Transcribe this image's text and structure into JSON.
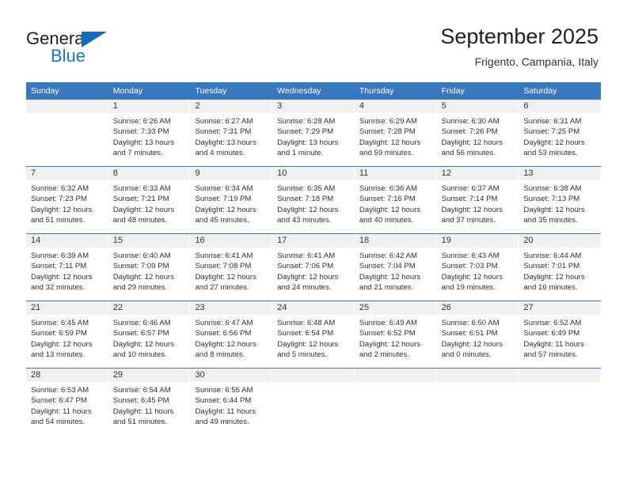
{
  "brand": {
    "name_part1": "General",
    "name_part2": "Blue",
    "accent_color": "#1b75bb",
    "triangle_color": "#156cb4"
  },
  "header": {
    "title": "September 2025",
    "subtitle": "Frigento, Campania, Italy"
  },
  "theme": {
    "header_row_bg": "#3a78bd",
    "day_band_bg": "#f0f0f0",
    "row_divider": "#3a78bd"
  },
  "weekdays": [
    "Sunday",
    "Monday",
    "Tuesday",
    "Wednesday",
    "Thursday",
    "Friday",
    "Saturday"
  ],
  "weeks": [
    [
      {
        "day": "",
        "lines": []
      },
      {
        "day": "1",
        "lines": [
          "Sunrise: 6:26 AM",
          "Sunset: 7:33 PM",
          "Daylight: 13 hours",
          "and 7 minutes."
        ]
      },
      {
        "day": "2",
        "lines": [
          "Sunrise: 6:27 AM",
          "Sunset: 7:31 PM",
          "Daylight: 13 hours",
          "and 4 minutes."
        ]
      },
      {
        "day": "3",
        "lines": [
          "Sunrise: 6:28 AM",
          "Sunset: 7:29 PM",
          "Daylight: 13 hours",
          "and 1 minute."
        ]
      },
      {
        "day": "4",
        "lines": [
          "Sunrise: 6:29 AM",
          "Sunset: 7:28 PM",
          "Daylight: 12 hours",
          "and 59 minutes."
        ]
      },
      {
        "day": "5",
        "lines": [
          "Sunrise: 6:30 AM",
          "Sunset: 7:26 PM",
          "Daylight: 12 hours",
          "and 56 minutes."
        ]
      },
      {
        "day": "6",
        "lines": [
          "Sunrise: 6:31 AM",
          "Sunset: 7:25 PM",
          "Daylight: 12 hours",
          "and 53 minutes."
        ]
      }
    ],
    [
      {
        "day": "7",
        "lines": [
          "Sunrise: 6:32 AM",
          "Sunset: 7:23 PM",
          "Daylight: 12 hours",
          "and 51 minutes."
        ]
      },
      {
        "day": "8",
        "lines": [
          "Sunrise: 6:33 AM",
          "Sunset: 7:21 PM",
          "Daylight: 12 hours",
          "and 48 minutes."
        ]
      },
      {
        "day": "9",
        "lines": [
          "Sunrise: 6:34 AM",
          "Sunset: 7:19 PM",
          "Daylight: 12 hours",
          "and 45 minutes."
        ]
      },
      {
        "day": "10",
        "lines": [
          "Sunrise: 6:35 AM",
          "Sunset: 7:18 PM",
          "Daylight: 12 hours",
          "and 43 minutes."
        ]
      },
      {
        "day": "11",
        "lines": [
          "Sunrise: 6:36 AM",
          "Sunset: 7:16 PM",
          "Daylight: 12 hours",
          "and 40 minutes."
        ]
      },
      {
        "day": "12",
        "lines": [
          "Sunrise: 6:37 AM",
          "Sunset: 7:14 PM",
          "Daylight: 12 hours",
          "and 37 minutes."
        ]
      },
      {
        "day": "13",
        "lines": [
          "Sunrise: 6:38 AM",
          "Sunset: 7:13 PM",
          "Daylight: 12 hours",
          "and 35 minutes."
        ]
      }
    ],
    [
      {
        "day": "14",
        "lines": [
          "Sunrise: 6:39 AM",
          "Sunset: 7:11 PM",
          "Daylight: 12 hours",
          "and 32 minutes."
        ]
      },
      {
        "day": "15",
        "lines": [
          "Sunrise: 6:40 AM",
          "Sunset: 7:09 PM",
          "Daylight: 12 hours",
          "and 29 minutes."
        ]
      },
      {
        "day": "16",
        "lines": [
          "Sunrise: 6:41 AM",
          "Sunset: 7:08 PM",
          "Daylight: 12 hours",
          "and 27 minutes."
        ]
      },
      {
        "day": "17",
        "lines": [
          "Sunrise: 6:41 AM",
          "Sunset: 7:06 PM",
          "Daylight: 12 hours",
          "and 24 minutes."
        ]
      },
      {
        "day": "18",
        "lines": [
          "Sunrise: 6:42 AM",
          "Sunset: 7:04 PM",
          "Daylight: 12 hours",
          "and 21 minutes."
        ]
      },
      {
        "day": "19",
        "lines": [
          "Sunrise: 6:43 AM",
          "Sunset: 7:03 PM",
          "Daylight: 12 hours",
          "and 19 minutes."
        ]
      },
      {
        "day": "20",
        "lines": [
          "Sunrise: 6:44 AM",
          "Sunset: 7:01 PM",
          "Daylight: 12 hours",
          "and 16 minutes."
        ]
      }
    ],
    [
      {
        "day": "21",
        "lines": [
          "Sunrise: 6:45 AM",
          "Sunset: 6:59 PM",
          "Daylight: 12 hours",
          "and 13 minutes."
        ]
      },
      {
        "day": "22",
        "lines": [
          "Sunrise: 6:46 AM",
          "Sunset: 6:57 PM",
          "Daylight: 12 hours",
          "and 10 minutes."
        ]
      },
      {
        "day": "23",
        "lines": [
          "Sunrise: 6:47 AM",
          "Sunset: 6:56 PM",
          "Daylight: 12 hours",
          "and 8 minutes."
        ]
      },
      {
        "day": "24",
        "lines": [
          "Sunrise: 6:48 AM",
          "Sunset: 6:54 PM",
          "Daylight: 12 hours",
          "and 5 minutes."
        ]
      },
      {
        "day": "25",
        "lines": [
          "Sunrise: 6:49 AM",
          "Sunset: 6:52 PM",
          "Daylight: 12 hours",
          "and 2 minutes."
        ]
      },
      {
        "day": "26",
        "lines": [
          "Sunrise: 6:50 AM",
          "Sunset: 6:51 PM",
          "Daylight: 12 hours",
          "and 0 minutes."
        ]
      },
      {
        "day": "27",
        "lines": [
          "Sunrise: 6:52 AM",
          "Sunset: 6:49 PM",
          "Daylight: 11 hours",
          "and 57 minutes."
        ]
      }
    ],
    [
      {
        "day": "28",
        "lines": [
          "Sunrise: 6:53 AM",
          "Sunset: 6:47 PM",
          "Daylight: 11 hours",
          "and 54 minutes."
        ]
      },
      {
        "day": "29",
        "lines": [
          "Sunrise: 6:54 AM",
          "Sunset: 6:45 PM",
          "Daylight: 11 hours",
          "and 51 minutes."
        ]
      },
      {
        "day": "30",
        "lines": [
          "Sunrise: 6:55 AM",
          "Sunset: 6:44 PM",
          "Daylight: 11 hours",
          "and 49 minutes."
        ]
      },
      {
        "day": "",
        "lines": []
      },
      {
        "day": "",
        "lines": []
      },
      {
        "day": "",
        "lines": []
      },
      {
        "day": "",
        "lines": []
      }
    ]
  ]
}
